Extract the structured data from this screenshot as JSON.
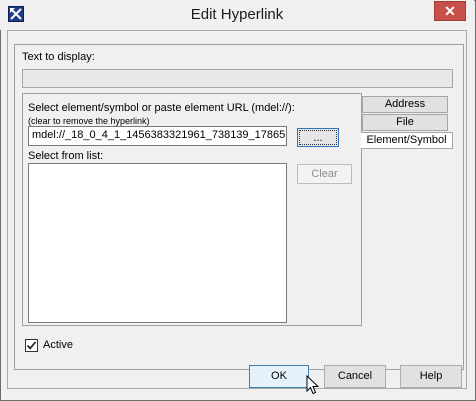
{
  "window": {
    "title": "Edit Hyperlink",
    "close_symbol": "✕"
  },
  "form": {
    "text_to_display_label": "Text to display:",
    "text_to_display_value": "",
    "select_label": "Select element/symbol or paste element URL (mdel://):",
    "select_hint": "(clear to remove the hyperlink)",
    "url_value": "mdel://_18_0_4_1_1456383321961_738139_17865",
    "browse_label": "...",
    "list_label": "Select from list:",
    "clear_label": "Clear"
  },
  "tabs": [
    {
      "label": "Address",
      "active": false
    },
    {
      "label": "File",
      "active": false
    },
    {
      "label": "Element/Symbol",
      "active": true
    }
  ],
  "active_checkbox": {
    "label": "Active",
    "checked": true
  },
  "buttons": {
    "ok": "OK",
    "cancel": "Cancel",
    "help": "Help"
  },
  "icons": {
    "app": "magicdraw-app-icon",
    "close": "close-icon",
    "check": "check-icon",
    "cursor": "mouse-pointer-icon"
  }
}
